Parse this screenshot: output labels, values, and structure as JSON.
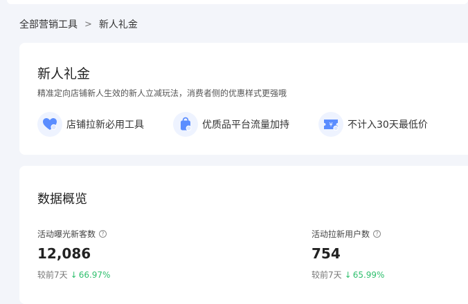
{
  "breadcrumb": {
    "parent": "全部营销工具",
    "separator": ">",
    "current": "新人礼金"
  },
  "intro": {
    "title": "新人礼金",
    "description": "精准定向店铺新人生效的新人立减玩法，消费者侧的优惠样式更强哦",
    "features": [
      {
        "icon": "heart-icon",
        "label": "店铺拉新必用工具"
      },
      {
        "icon": "bag-icon",
        "label": "优质品平台流量加持"
      },
      {
        "icon": "coupon-icon",
        "label": "不计入30天最低价"
      }
    ]
  },
  "overview": {
    "title": "数据概览",
    "metrics": [
      {
        "label": "活动曝光新客数",
        "help_icon": "?",
        "value": "12,086",
        "compare_label": "较前7天",
        "trend_direction": "down",
        "trend_value": "66.97%"
      },
      {
        "label": "活动拉新用户数",
        "help_icon": "?",
        "value": "754",
        "compare_label": "较前7天",
        "trend_direction": "down",
        "trend_value": "65.99%"
      }
    ]
  },
  "colors": {
    "accent": "#4d7cfe",
    "trend_down": "#2ebf6d",
    "page_bg": "#f3f5fa"
  }
}
